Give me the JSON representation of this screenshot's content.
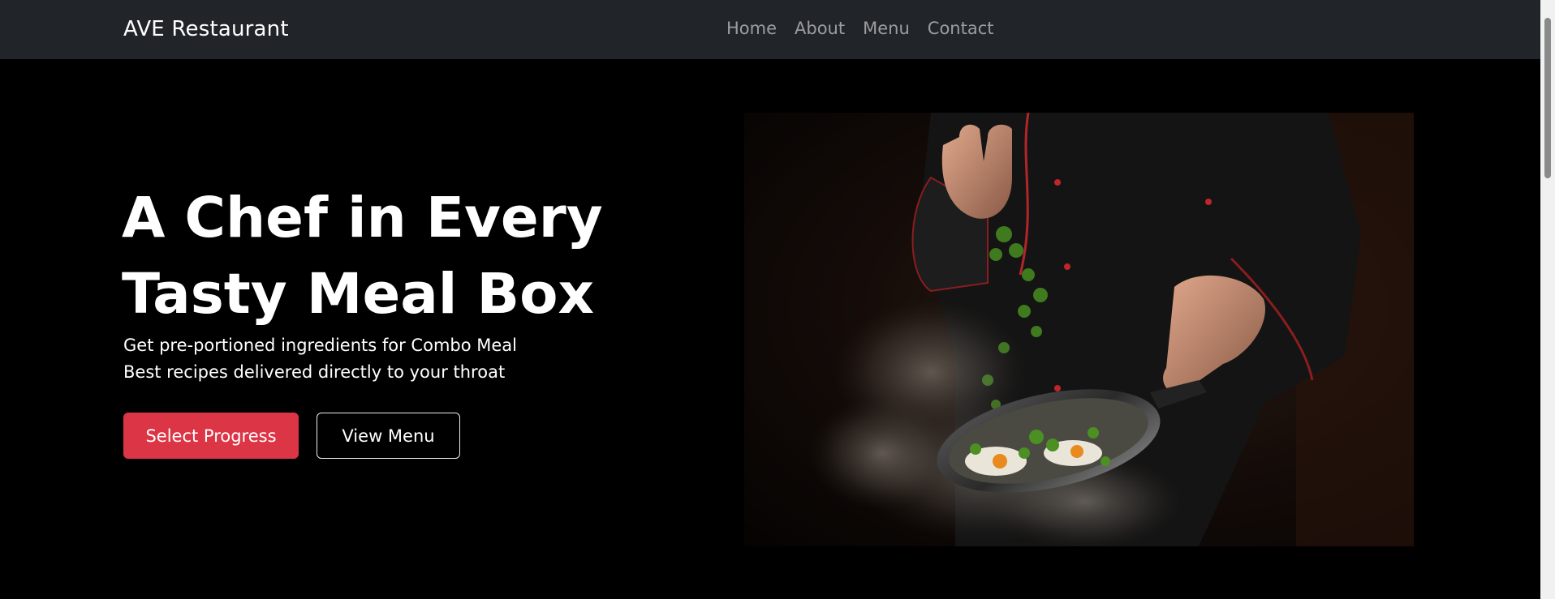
{
  "navbar": {
    "brand": "AVE Restaurant",
    "links": [
      "Home",
      "About",
      "Menu",
      "Contact"
    ]
  },
  "hero": {
    "title": "A Chef in Every Tasty Meal Box",
    "subtitle_line1": "Get pre-portioned ingredients for Combo Meal",
    "subtitle_line2": "Best recipes delivered directly to your throat",
    "primary_button": "Select Progress",
    "secondary_button": "View Menu"
  },
  "colors": {
    "navbar_bg": "#212529",
    "page_bg": "#000000",
    "primary": "#dc3545",
    "text": "#ffffff",
    "nav_link": "rgba(255,255,255,0.55)"
  },
  "icons": {
    "hero_image": "chef-cooking-photo"
  }
}
